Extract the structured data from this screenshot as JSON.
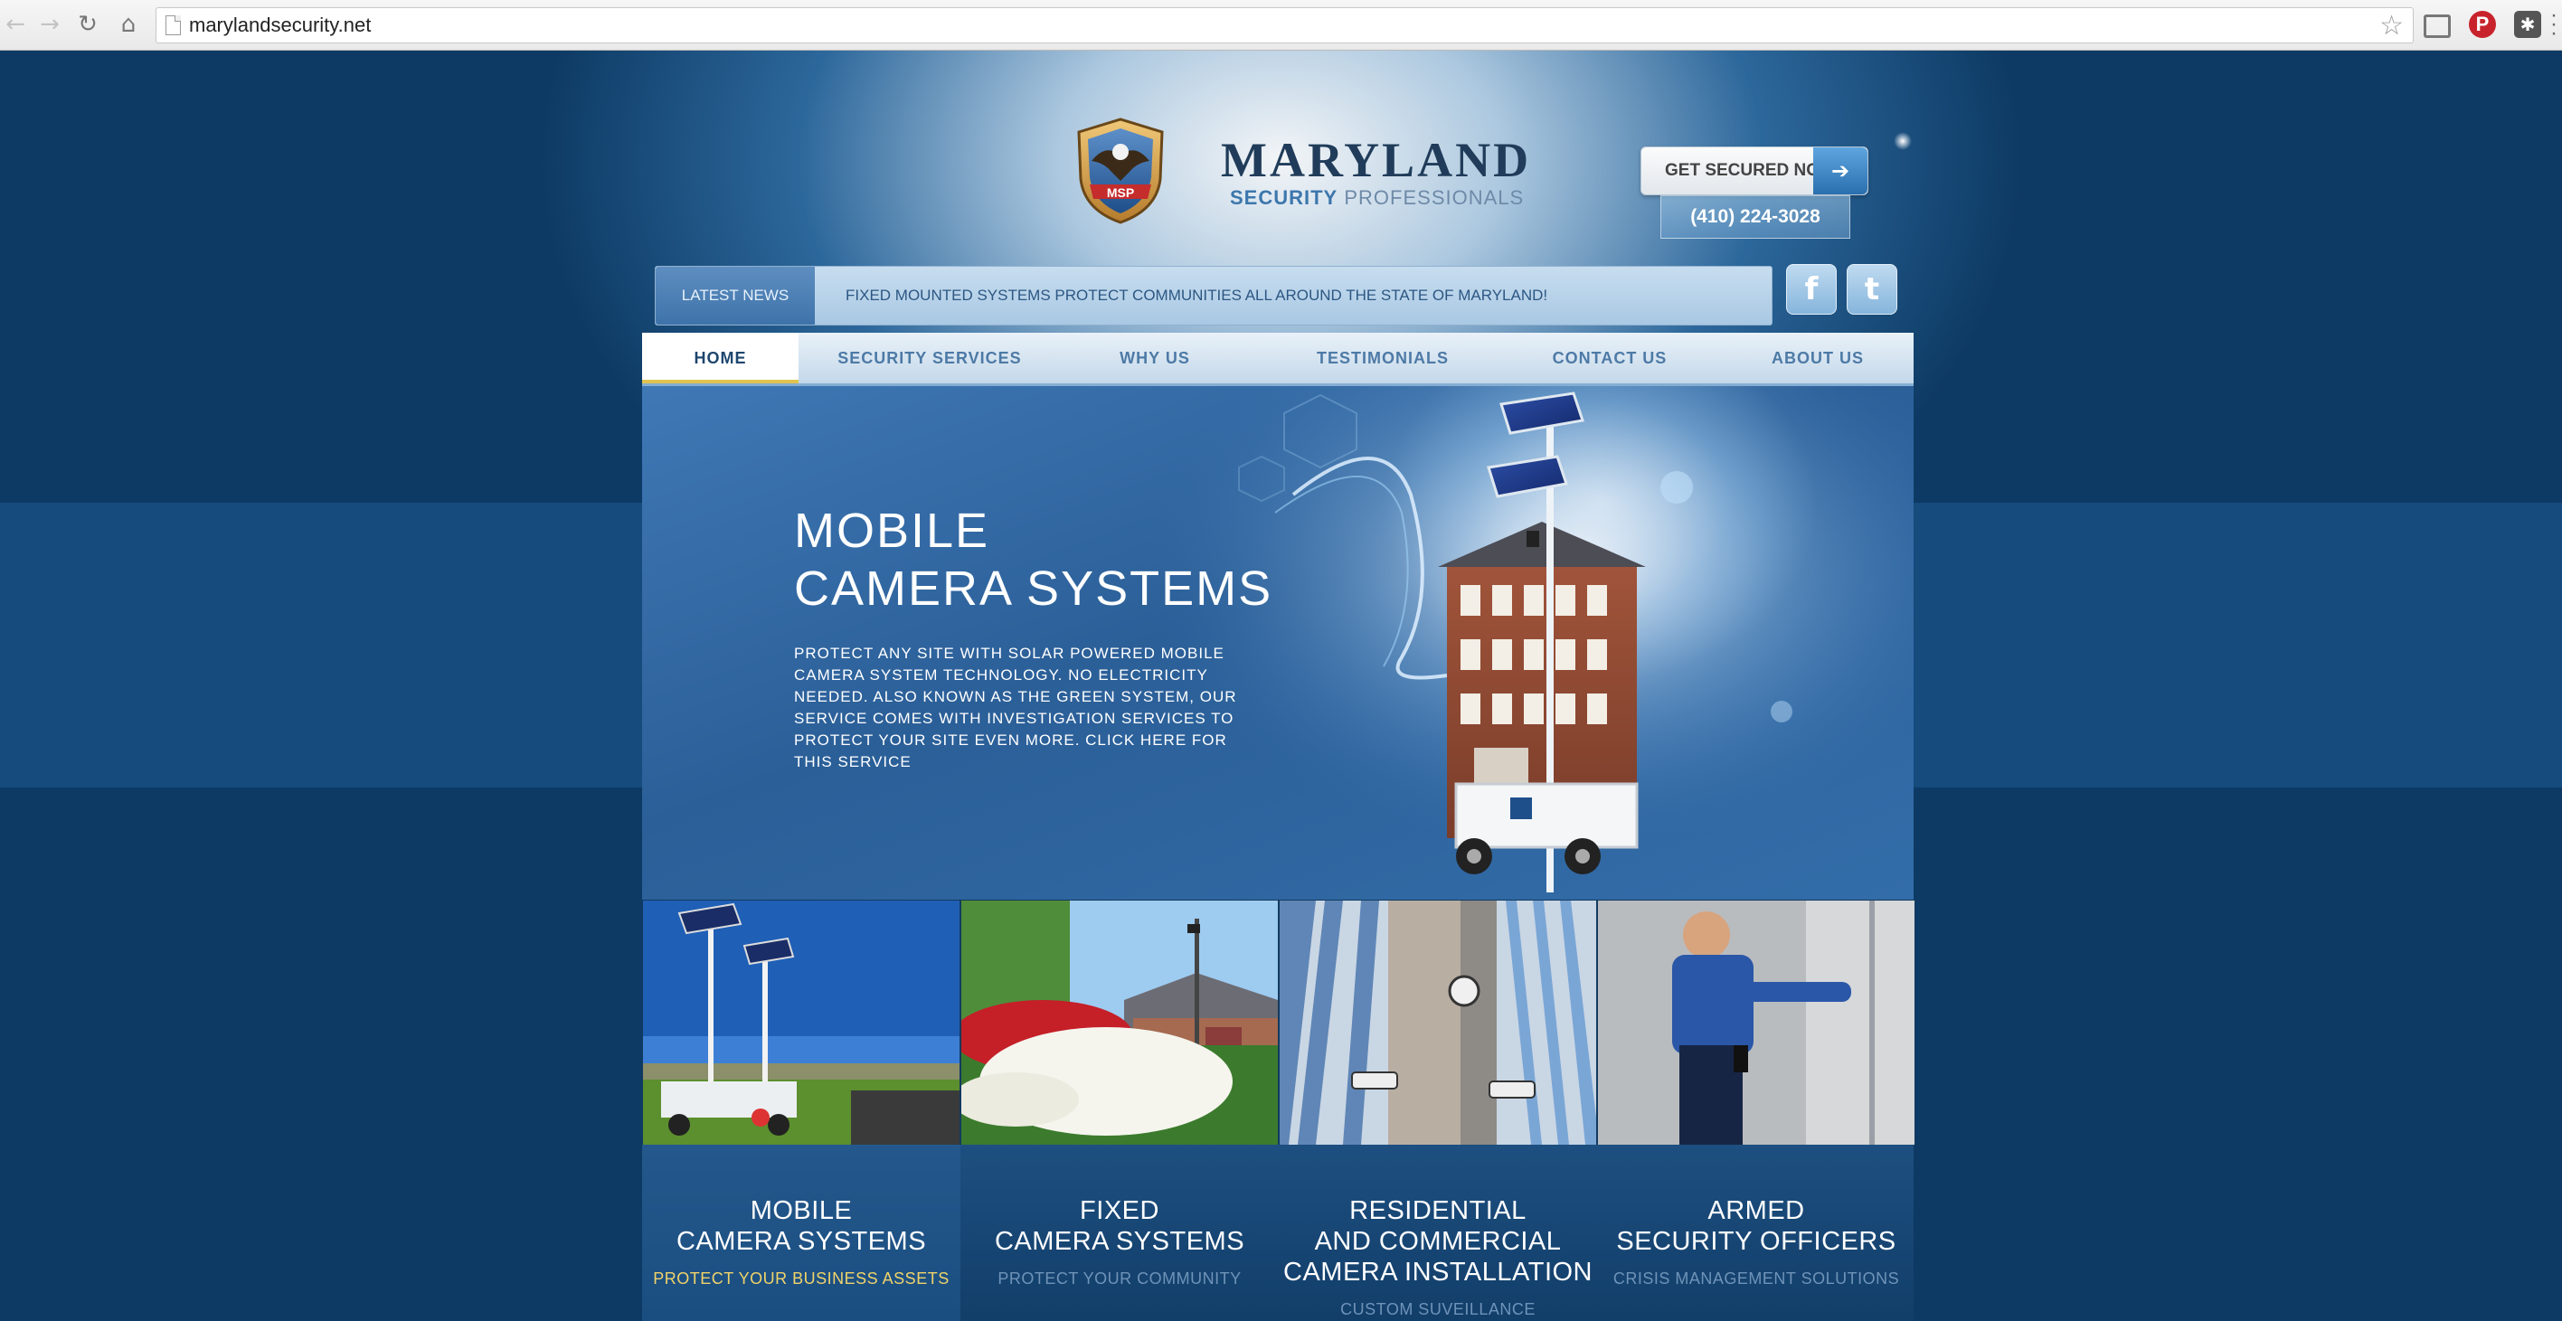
{
  "browser": {
    "url": "marylandsecurity.net",
    "back_icon": "back-arrow-icon",
    "forward_icon": "forward-arrow-icon",
    "reload_icon": "reload-icon",
    "home_icon": "home-icon",
    "star_icon": "star-icon"
  },
  "header": {
    "brand_name": "MARYLAND",
    "brand_sub_a": "SECURITY",
    "brand_sub_b": "PROFESSIONALS",
    "badge_text": "MSP",
    "cta_label": "GET SECURED NOW",
    "cta_arrow": "➔",
    "phone": "(410) 224-3028"
  },
  "news": {
    "label": "LATEST NEWS",
    "text": "FIXED MOUNTED SYSTEMS PROTECT COMMUNITIES ALL AROUND THE STATE OF MARYLAND!"
  },
  "social": {
    "facebook": "f",
    "twitter": "t"
  },
  "nav": {
    "items": [
      {
        "label": "HOME"
      },
      {
        "label": "SECURITY SERVICES"
      },
      {
        "label": "WHY US"
      },
      {
        "label": "TESTIMONIALS"
      },
      {
        "label": "CONTACT US"
      },
      {
        "label": "ABOUT US"
      }
    ]
  },
  "hero": {
    "title_line1": "MOBILE",
    "title_line2": "CAMERA SYSTEMS",
    "text": "PROTECT ANY SITE WITH SOLAR POWERED MOBILE CAMERA SYSTEM TECHNOLOGY. NO ELECTRICITY NEEDED. ALSO KNOWN AS THE GREEN SYSTEM, OUR SERVICE COMES WITH INVESTIGATION SERVICES TO PROTECT YOUR SITE EVEN MORE. CLICK HERE FOR THIS SERVICE"
  },
  "services": [
    {
      "title_lines": [
        "MOBILE",
        "CAMERA SYSTEMS"
      ],
      "subtitle": "PROTECT YOUR BUSINESS ASSETS"
    },
    {
      "title_lines": [
        "FIXED",
        "CAMERA SYSTEMS"
      ],
      "subtitle": "PROTECT YOUR COMMUNITY"
    },
    {
      "title_lines": [
        "RESIDENTIAL",
        "AND COMMERCIAL",
        "CAMERA INSTALLATION"
      ],
      "subtitle": "CUSTOM SUVEILLANCE"
    },
    {
      "title_lines": [
        "ARMED",
        "SECURITY OFFICERS"
      ],
      "subtitle": "CRISIS MANAGEMENT SOLUTIONS"
    }
  ],
  "colors": {
    "highlight_subtitle": "#f0d36a",
    "muted_subtitle": "#6f93b8"
  }
}
